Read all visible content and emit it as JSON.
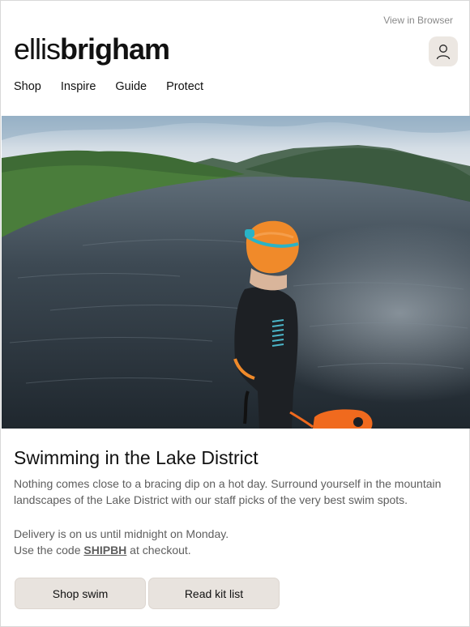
{
  "header": {
    "view_in_browser": "View in Browser",
    "logo_light": "ellis",
    "logo_bold": "brigham",
    "account_icon": "user-icon"
  },
  "nav": {
    "items": [
      "Shop",
      "Inspire",
      "Guide",
      "Protect"
    ]
  },
  "hero": {
    "image_description_icon": "lake-swimmer-photo"
  },
  "article": {
    "title": "Swimming in the Lake District",
    "body": "Nothing comes close to a bracing dip on a hot day. Surround yourself in the mountain landscapes of the Lake District with our staff picks of the very best swim spots.",
    "delivery_line": "Delivery is on us until midnight on Monday.",
    "code_prefix": "Use the code ",
    "code": "SHIPBH",
    "code_suffix": " at checkout."
  },
  "buttons": {
    "shop_swim": "Shop swim",
    "read_kit_list": "Read kit list"
  },
  "colors": {
    "button_bg": "#e8e3de",
    "text_muted": "#5e5e5e",
    "cap_orange": "#f08a2a",
    "goggle_teal": "#2ab3c6"
  }
}
